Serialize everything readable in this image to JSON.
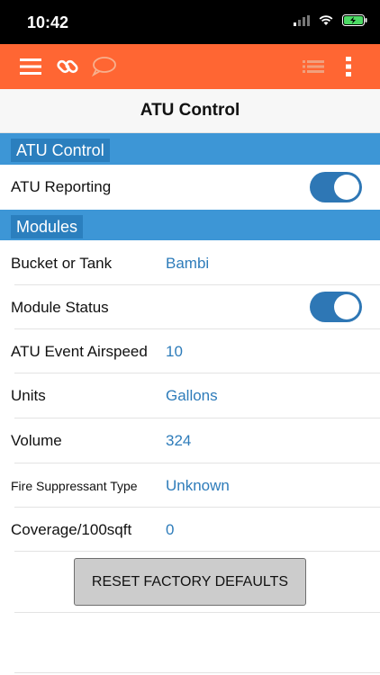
{
  "status_bar": {
    "time": "10:42"
  },
  "toolbar": {
    "menu_icon": "hamburger-menu-icon",
    "link_icon": "chain-link-icon",
    "chat_icon": "speech-bubble-icon",
    "list_icon": "list-icon",
    "more_icon": "vertical-ellipsis-icon",
    "background": "#ff6633"
  },
  "header": {
    "title": "ATU Control"
  },
  "sections": {
    "atu_control": {
      "label": "ATU Control",
      "reporting": {
        "label": "ATU Reporting",
        "enabled": true
      }
    },
    "modules": {
      "label": "Modules",
      "rows": [
        {
          "label": "Bucket or Tank",
          "value": "Bambi"
        },
        {
          "label": "Module Status",
          "toggle": true,
          "enabled": true
        },
        {
          "label": "ATU Event Airspeed",
          "value": "10"
        },
        {
          "label": "Units",
          "value": "Gallons"
        },
        {
          "label": "Volume",
          "value": "324"
        },
        {
          "label": "Fire Suppressant Type",
          "value": "Unknown"
        },
        {
          "label": "Coverage/100sqft",
          "value": "0"
        }
      ]
    }
  },
  "reset_button": {
    "label": "RESET FACTORY DEFAULTS"
  },
  "colors": {
    "accent": "#ff6633",
    "section": "#3d96d6",
    "value_text": "#2e7cba",
    "toggle_on": "#2e77b5"
  }
}
